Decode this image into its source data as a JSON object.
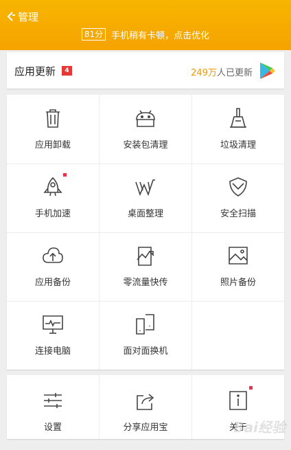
{
  "header": {
    "title": "管理",
    "score": "81分",
    "message": "手机稍有卡顿，点击优化",
    "color": "#f6a800"
  },
  "update": {
    "label": "应用更新",
    "badge": "4",
    "count_num": "249万",
    "count_text": "人已更新",
    "icon": "play-store-icon"
  },
  "grid": [
    {
      "label": "应用卸载",
      "icon": "trash-icon"
    },
    {
      "label": "安装包清理",
      "icon": "android-package-icon"
    },
    {
      "label": "垃圾清理",
      "icon": "broom-icon"
    },
    {
      "label": "手机加速",
      "icon": "rocket-icon"
    },
    {
      "label": "桌面整理",
      "icon": "desktop-tidy-icon"
    },
    {
      "label": "安全扫描",
      "icon": "shield-scan-icon"
    },
    {
      "label": "应用备份",
      "icon": "cloud-upload-icon"
    },
    {
      "label": "零流量快传",
      "icon": "zero-traffic-transfer-icon"
    },
    {
      "label": "照片备份",
      "icon": "photo-icon"
    },
    {
      "label": "连接电脑",
      "icon": "monitor-icon"
    },
    {
      "label": "面对面换机",
      "icon": "phone-swap-icon"
    }
  ],
  "bottom": [
    {
      "label": "设置",
      "icon": "settings-sliders-icon"
    },
    {
      "label": "分享应用宝",
      "icon": "share-icon"
    },
    {
      "label": "关于",
      "icon": "info-icon"
    }
  ],
  "watermark": "Bai经验"
}
